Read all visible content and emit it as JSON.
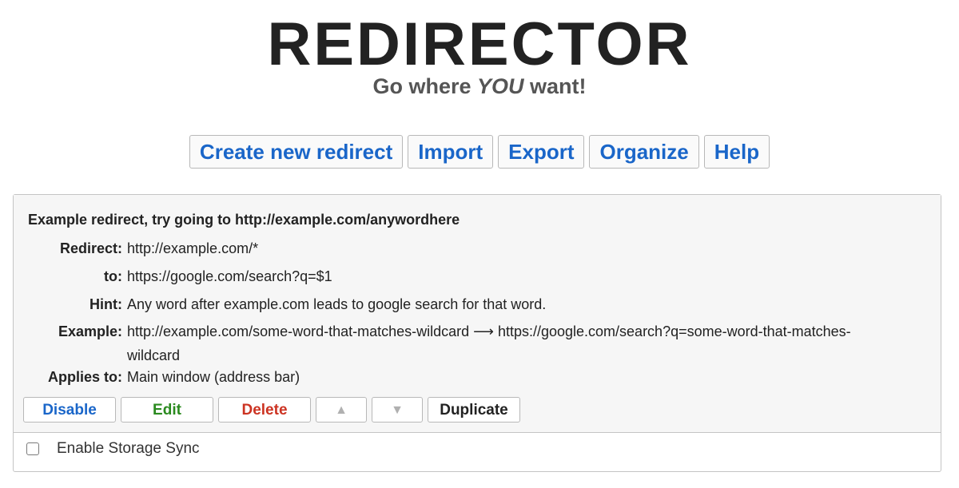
{
  "header": {
    "logo": "REDIRECTOR",
    "tagline_pre": "Go where ",
    "tagline_em": "YOU",
    "tagline_post": " want!"
  },
  "menu": {
    "create": "Create new redirect",
    "import": "Import",
    "export": "Export",
    "organize": "Organize",
    "help": "Help"
  },
  "redirect": {
    "title": "Example redirect, try going to http://example.com/anywordhere",
    "fields": [
      {
        "label": "Redirect:",
        "value": "http://example.com/*"
      },
      {
        "label": "to:",
        "value": "https://google.com/search?q=$1"
      },
      {
        "label": "Hint:",
        "value": "Any word after example.com leads to google search for that word."
      },
      {
        "label": "Example:",
        "value": "http://example.com/some-word-that-matches-wildcard ⟶ https://google.com/search?q=some-word-that-matches-wildcard"
      },
      {
        "label": "Applies to:",
        "value": "Main window (address bar)"
      }
    ],
    "actions": {
      "disable": "Disable",
      "edit": "Edit",
      "delete": "Delete",
      "up": "▲",
      "down": "▼",
      "duplicate": "Duplicate"
    }
  },
  "sync": {
    "label": "Enable Storage Sync",
    "checked": false
  },
  "colors": {
    "accent_blue": "#1a66c9",
    "edit_green": "#2a8a1f",
    "delete_red": "#cc3322"
  }
}
